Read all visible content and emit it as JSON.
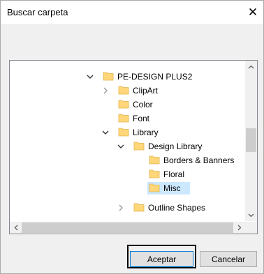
{
  "dialog": {
    "title": "Buscar carpeta",
    "close_glyph": "✕"
  },
  "tree": {
    "items": [
      {
        "label": "PE-DESIGN PLUS2",
        "expander": "expanded"
      },
      {
        "label": "ClipArt",
        "expander": "collapsed"
      },
      {
        "label": "Color",
        "expander": "none"
      },
      {
        "label": "Font",
        "expander": "none"
      },
      {
        "label": "Library",
        "expander": "expanded"
      },
      {
        "label": "Design Library",
        "expander": "expanded"
      },
      {
        "label": "Borders & Banners",
        "expander": "none"
      },
      {
        "label": "Floral",
        "expander": "none"
      },
      {
        "label": "Misc",
        "expander": "none",
        "selected": true
      },
      {
        "label": "Outline Shapes",
        "expander": "collapsed"
      }
    ]
  },
  "buttons": {
    "accept": "Aceptar",
    "cancel": "Cancelar"
  },
  "colors": {
    "folder_fill": "#ffd77a",
    "folder_tab": "#f4c85a",
    "selection": "#cce8ff",
    "scroll_thumb": "#cdcdcd"
  }
}
